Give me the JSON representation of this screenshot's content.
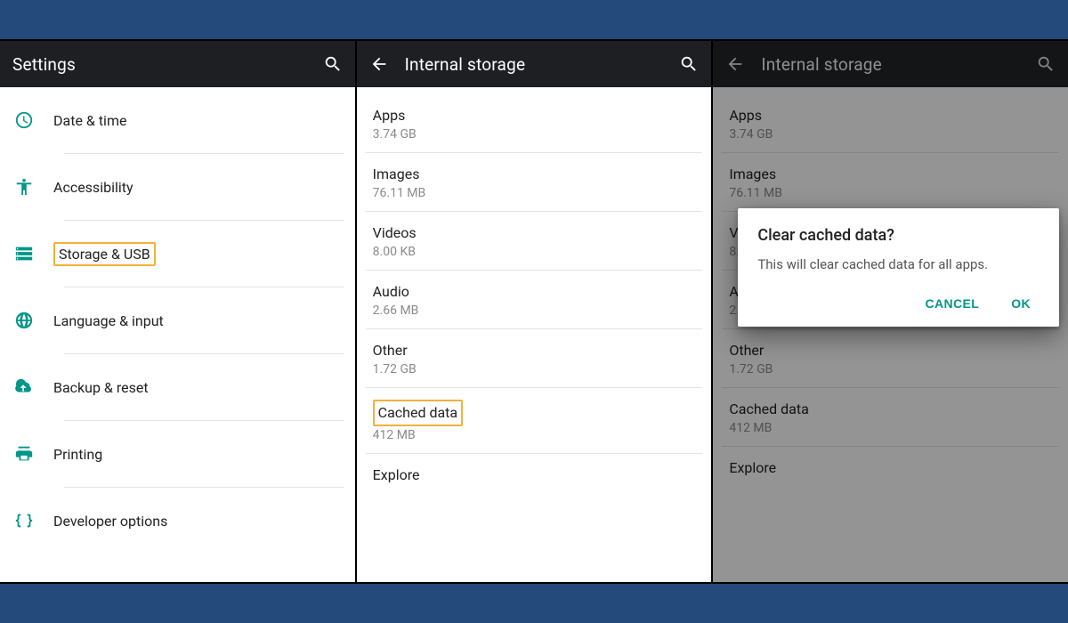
{
  "colors": {
    "accent": "#009688",
    "appbar": "#1d1f22",
    "page_bg": "#234a7a",
    "highlight": "#f2b23a"
  },
  "panel1": {
    "title": "Settings",
    "items": [
      {
        "label": "Date & time",
        "icon": "clock-icon"
      },
      {
        "label": "Accessibility",
        "icon": "accessibility-icon"
      },
      {
        "label": "Storage & USB",
        "icon": "storage-icon",
        "highlighted": true
      },
      {
        "label": "Language & input",
        "icon": "globe-icon"
      },
      {
        "label": "Backup & reset",
        "icon": "backup-icon"
      },
      {
        "label": "Printing",
        "icon": "print-icon"
      },
      {
        "label": "Developer options",
        "icon": "braces-icon"
      }
    ]
  },
  "panel2": {
    "title": "Internal storage",
    "items": [
      {
        "label": "Apps",
        "sub": "3.74 GB"
      },
      {
        "label": "Images",
        "sub": "76.11 MB"
      },
      {
        "label": "Videos",
        "sub": "8.00 KB"
      },
      {
        "label": "Audio",
        "sub": "2.66 MB"
      },
      {
        "label": "Other",
        "sub": "1.72 GB"
      },
      {
        "label": "Cached data",
        "sub": "412 MB",
        "highlighted": true
      },
      {
        "label": "Explore",
        "sub": ""
      }
    ]
  },
  "panel3": {
    "title": "Internal storage",
    "items": [
      {
        "label": "Apps",
        "sub": "3.74 GB"
      },
      {
        "label": "Images",
        "sub": "76.11 MB"
      },
      {
        "label": "Videos",
        "sub": "8.00 KB"
      },
      {
        "label": "Audio",
        "sub": "2.66 MB"
      },
      {
        "label": "Other",
        "sub": "1.72 GB"
      },
      {
        "label": "Cached data",
        "sub": "412 MB"
      },
      {
        "label": "Explore",
        "sub": ""
      }
    ],
    "dialog": {
      "title": "Clear cached data?",
      "body": "This will clear cached data for all apps.",
      "cancel": "CANCEL",
      "ok": "OK"
    }
  }
}
